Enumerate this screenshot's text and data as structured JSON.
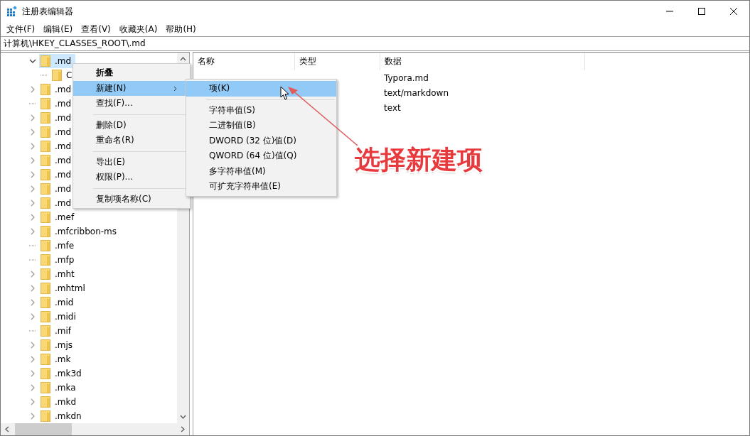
{
  "window": {
    "title": "注册表编辑器"
  },
  "menu_bar": [
    "文件(F)",
    "编辑(E)",
    "查看(V)",
    "收藏夹(A)",
    "帮助(H)"
  ],
  "address": "计算机\\HKEY_CLASSES_ROOT\\.md",
  "tree": [
    {
      "label": ".md",
      "expandable": true,
      "expanded": true,
      "selected": true,
      "children": [
        {
          "label": "C",
          "expandable": false,
          "selected": false
        }
      ]
    },
    {
      "label": ".md",
      "expandable": true,
      "expanded": false,
      "selected": false
    },
    {
      "label": ".md",
      "expandable": false,
      "selected": false
    },
    {
      "label": ".md",
      "expandable": true,
      "expanded": false,
      "selected": false
    },
    {
      "label": ".md",
      "expandable": true,
      "expanded": false,
      "selected": false
    },
    {
      "label": ".md",
      "expandable": true,
      "expanded": false,
      "selected": false
    },
    {
      "label": ".md",
      "expandable": true,
      "expanded": false,
      "selected": false
    },
    {
      "label": ".md",
      "expandable": true,
      "expanded": false,
      "selected": false
    },
    {
      "label": ".md",
      "expandable": true,
      "expanded": false,
      "selected": false
    },
    {
      "label": ".md",
      "expandable": true,
      "expanded": false,
      "selected": false
    },
    {
      "label": ".mef",
      "expandable": true,
      "expanded": false,
      "selected": false
    },
    {
      "label": ".mfcribbon-ms",
      "expandable": true,
      "expanded": false,
      "selected": false
    },
    {
      "label": ".mfe",
      "expandable": false,
      "selected": false
    },
    {
      "label": ".mfp",
      "expandable": false,
      "selected": false
    },
    {
      "label": ".mht",
      "expandable": true,
      "expanded": false,
      "selected": false
    },
    {
      "label": ".mhtml",
      "expandable": true,
      "expanded": false,
      "selected": false
    },
    {
      "label": ".mid",
      "expandable": true,
      "expanded": false,
      "selected": false
    },
    {
      "label": ".midi",
      "expandable": true,
      "expanded": false,
      "selected": false
    },
    {
      "label": ".mif",
      "expandable": false,
      "selected": false
    },
    {
      "label": ".mjs",
      "expandable": true,
      "expanded": false,
      "selected": false
    },
    {
      "label": ".mk",
      "expandable": true,
      "expanded": false,
      "selected": false
    },
    {
      "label": ".mk3d",
      "expandable": true,
      "expanded": false,
      "selected": false
    },
    {
      "label": ".mka",
      "expandable": true,
      "expanded": false,
      "selected": false
    },
    {
      "label": ".mkd",
      "expandable": true,
      "expanded": false,
      "selected": false
    },
    {
      "label": ".mkdn",
      "expandable": true,
      "expanded": false,
      "selected": false
    }
  ],
  "values": {
    "columns": [
      "名称",
      "类型",
      "数据"
    ],
    "rows": [
      {
        "data": "Typora.md"
      },
      {
        "data": "text/markdown"
      },
      {
        "data": "text"
      }
    ]
  },
  "context_menu": [
    {
      "kind": "item",
      "label": "折叠",
      "bold": true,
      "submenu": false,
      "selected": false
    },
    {
      "kind": "item",
      "label": "新建(N)",
      "bold": false,
      "submenu": true,
      "selected": true
    },
    {
      "kind": "item",
      "label": "查找(F)...",
      "bold": false,
      "submenu": false,
      "selected": false
    },
    {
      "kind": "separator"
    },
    {
      "kind": "item",
      "label": "删除(D)",
      "bold": false,
      "submenu": false,
      "selected": false
    },
    {
      "kind": "item",
      "label": "重命名(R)",
      "bold": false,
      "submenu": false,
      "selected": false
    },
    {
      "kind": "separator"
    },
    {
      "kind": "item",
      "label": "导出(E)",
      "bold": false,
      "submenu": false,
      "selected": false
    },
    {
      "kind": "item",
      "label": "权限(P)...",
      "bold": false,
      "submenu": false,
      "selected": false
    },
    {
      "kind": "separator"
    },
    {
      "kind": "item",
      "label": "复制项名称(C)",
      "bold": false,
      "submenu": false,
      "selected": false
    }
  ],
  "submenu": [
    {
      "kind": "item",
      "label": "项(K)",
      "selected": true
    },
    {
      "kind": "separator"
    },
    {
      "kind": "item",
      "label": "字符串值(S)",
      "selected": false
    },
    {
      "kind": "item",
      "label": "二进制值(B)",
      "selected": false
    },
    {
      "kind": "item",
      "label": "DWORD (32 位)值(D)",
      "selected": false
    },
    {
      "kind": "item",
      "label": "QWORD (64 位)值(Q)",
      "selected": false
    },
    {
      "kind": "item",
      "label": "多字符串值(M)",
      "selected": false
    },
    {
      "kind": "item",
      "label": "可扩充字符串值(E)",
      "selected": false
    }
  ],
  "annotation": {
    "text": "选择新建项"
  }
}
